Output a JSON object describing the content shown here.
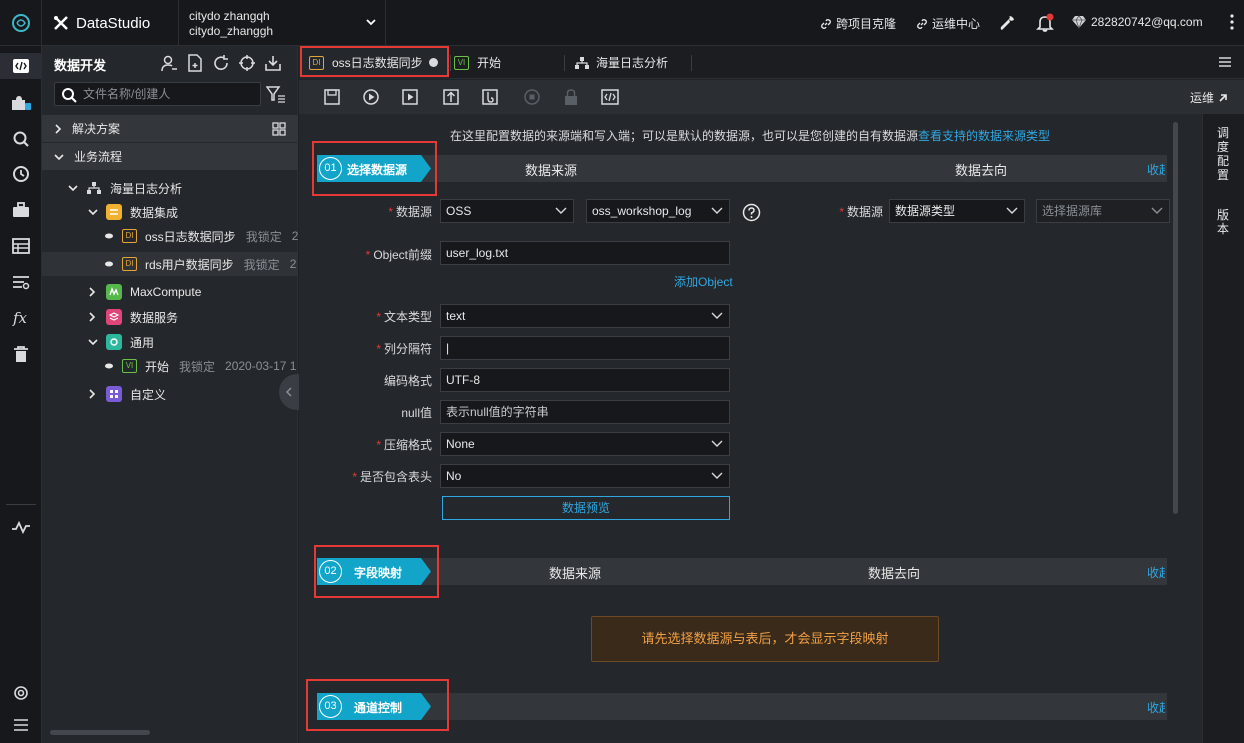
{
  "app": {
    "brand": "DataStudio",
    "workspace_line1": "citydo zhangqh",
    "workspace_line2": "citydo_zhanggh"
  },
  "topnav": {
    "clone": "跨项目克隆",
    "ops_center": "运维中心",
    "user": "282820742@qq.com"
  },
  "tree": {
    "title": "数据开发",
    "search_placeholder": "文件名称/创建人",
    "solutions": "解决方案",
    "business_flow": "业务流程",
    "flow_name": "海量日志分析",
    "data_integration": "数据集成",
    "node1": {
      "badge": "DI",
      "name": "oss日志数据同步",
      "lock": "我锁定",
      "extra": "2"
    },
    "node2": {
      "badge": "DI",
      "name": "rds用户数据同步",
      "lock": "我锁定",
      "extra": "2"
    },
    "maxcompute": "MaxCompute",
    "data_service": "数据服务",
    "general": "通用",
    "node3": {
      "badge": "VI",
      "name": "开始",
      "lock": "我锁定",
      "extra": "2020-03-17 1"
    },
    "custom": "自定义"
  },
  "tabs": [
    {
      "badge": "DI",
      "label": "oss日志数据同步"
    },
    {
      "badge": "VI",
      "label": "开始"
    },
    {
      "label": "海量日志分析"
    }
  ],
  "toolbar": {
    "ops_link": "运维"
  },
  "right_rail": {
    "schedule": "调度配置",
    "version": "版本"
  },
  "main": {
    "hint_text": "在这里配置数据的来源端和写入端；可以是默认的数据源，也可以是您创建的自有数据源",
    "hint_link": "查看支持的数据来源类型",
    "step1": {
      "num": "01",
      "label": "选择数据源",
      "source": "数据来源",
      "target": "数据去向",
      "collapse": "收起"
    },
    "step2": {
      "num": "02",
      "label": "字段映射",
      "source": "数据来源",
      "target": "数据去向",
      "collapse": "收起"
    },
    "step3": {
      "num": "03",
      "label": "通道控制",
      "collapse": "收起"
    },
    "form": {
      "datasource_label": "数据源",
      "datasource_type": "OSS",
      "datasource_name": "oss_workshop_log",
      "target_label": "数据源",
      "target_type_placeholder": "数据源类型",
      "target_db_placeholder": "选择据源库",
      "object_label": "Object前缀",
      "object_value": "user_log.txt",
      "add_object": "添加Object",
      "text_type_label": "文本类型",
      "text_type_value": "text",
      "delimiter_label": "列分隔符",
      "delimiter_value": "|",
      "encoding_label": "编码格式",
      "encoding_value": "UTF-8",
      "null_label": "null值",
      "null_placeholder": "表示null值的字符串",
      "compress_label": "压缩格式",
      "compress_value": "None",
      "header_label": "是否包含表头",
      "header_value": "No",
      "preview_button": "数据预览"
    },
    "warning": "请先选择数据源与表后，才会显示字段映射"
  }
}
